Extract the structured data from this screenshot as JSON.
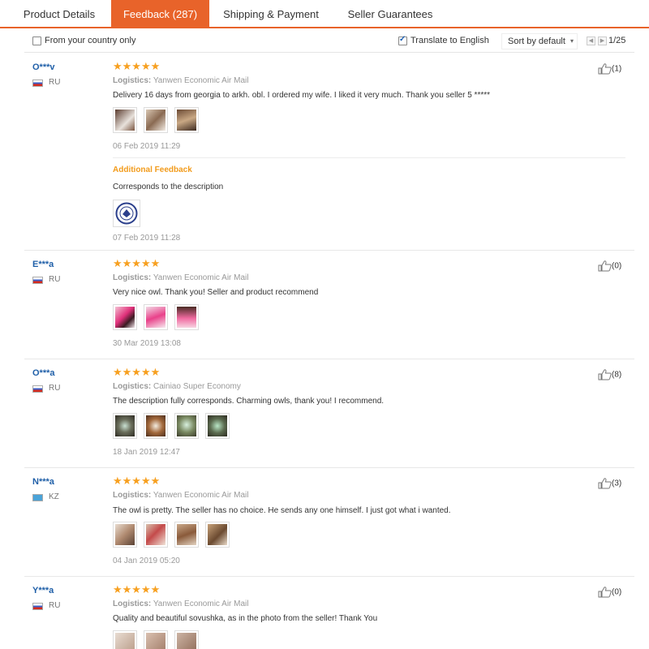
{
  "tabs": [
    {
      "label": "Product Details",
      "active": false
    },
    {
      "label": "Feedback (287)",
      "active": true
    },
    {
      "label": "Shipping & Payment",
      "active": false
    },
    {
      "label": "Seller Guarantees",
      "active": false
    }
  ],
  "filters": {
    "country_only_label": "From your country only",
    "country_only_checked": false,
    "translate_label": "Translate to English",
    "translate_checked": true,
    "sort_label": "Sort by default",
    "page_indicator": "1/25"
  },
  "colors": {
    "accent": "#e8632a",
    "username": "#1f5fa8",
    "stars": "#f7a020",
    "additional_feedback": "#f29b1b"
  },
  "logistics_label": "Logistics:",
  "reviews": [
    {
      "user": "O***v",
      "country": "RU",
      "flag": "ru",
      "rating": 5,
      "stars": "★★★★★",
      "logistics": "Yanwen Economic Air Mail",
      "text": "Delivery 16 days from georgia to arkh. obl. I ordered my wife. I liked it very much. Thank you seller 5 *****",
      "photos": 3,
      "date": "06 Feb 2019 11:29",
      "likes": "(1)",
      "additional": {
        "label": "Additional Feedback",
        "text": "Corresponds to the description",
        "date": "07 Feb 2019 11:28"
      }
    },
    {
      "user": "E***a",
      "country": "RU",
      "flag": "ru",
      "rating": 5,
      "stars": "★★★★★",
      "logistics": "Yanwen Economic Air Mail",
      "text": "Very nice owl. Thank you! Seller and product recommend",
      "photos": 3,
      "date": "30 Mar 2019 13:08",
      "likes": "(0)"
    },
    {
      "user": "O***a",
      "country": "RU",
      "flag": "ru",
      "rating": 5,
      "stars": "★★★★★",
      "logistics": "Cainiao Super Economy",
      "text": "The description fully corresponds. Charming owls, thank you! I recommend.",
      "photos": 4,
      "date": "18 Jan 2019 12:47",
      "likes": "(8)"
    },
    {
      "user": "N***a",
      "country": "KZ",
      "flag": "kz",
      "rating": 5,
      "stars": "★★★★★",
      "logistics": "Yanwen Economic Air Mail",
      "text": "The owl is pretty. The seller has no choice. He sends any one himself. I just got what i wanted.",
      "photos": 4,
      "date": "04 Jan 2019 05:20",
      "likes": "(3)"
    },
    {
      "user": "Y***a",
      "country": "RU",
      "flag": "ru",
      "rating": 5,
      "stars": "★★★★★",
      "logistics": "Yanwen Economic Air Mail",
      "text": "Quality and beautiful sovushka, as in the photo from the seller! Thank You",
      "photos": 3,
      "likes": "(0)"
    }
  ]
}
